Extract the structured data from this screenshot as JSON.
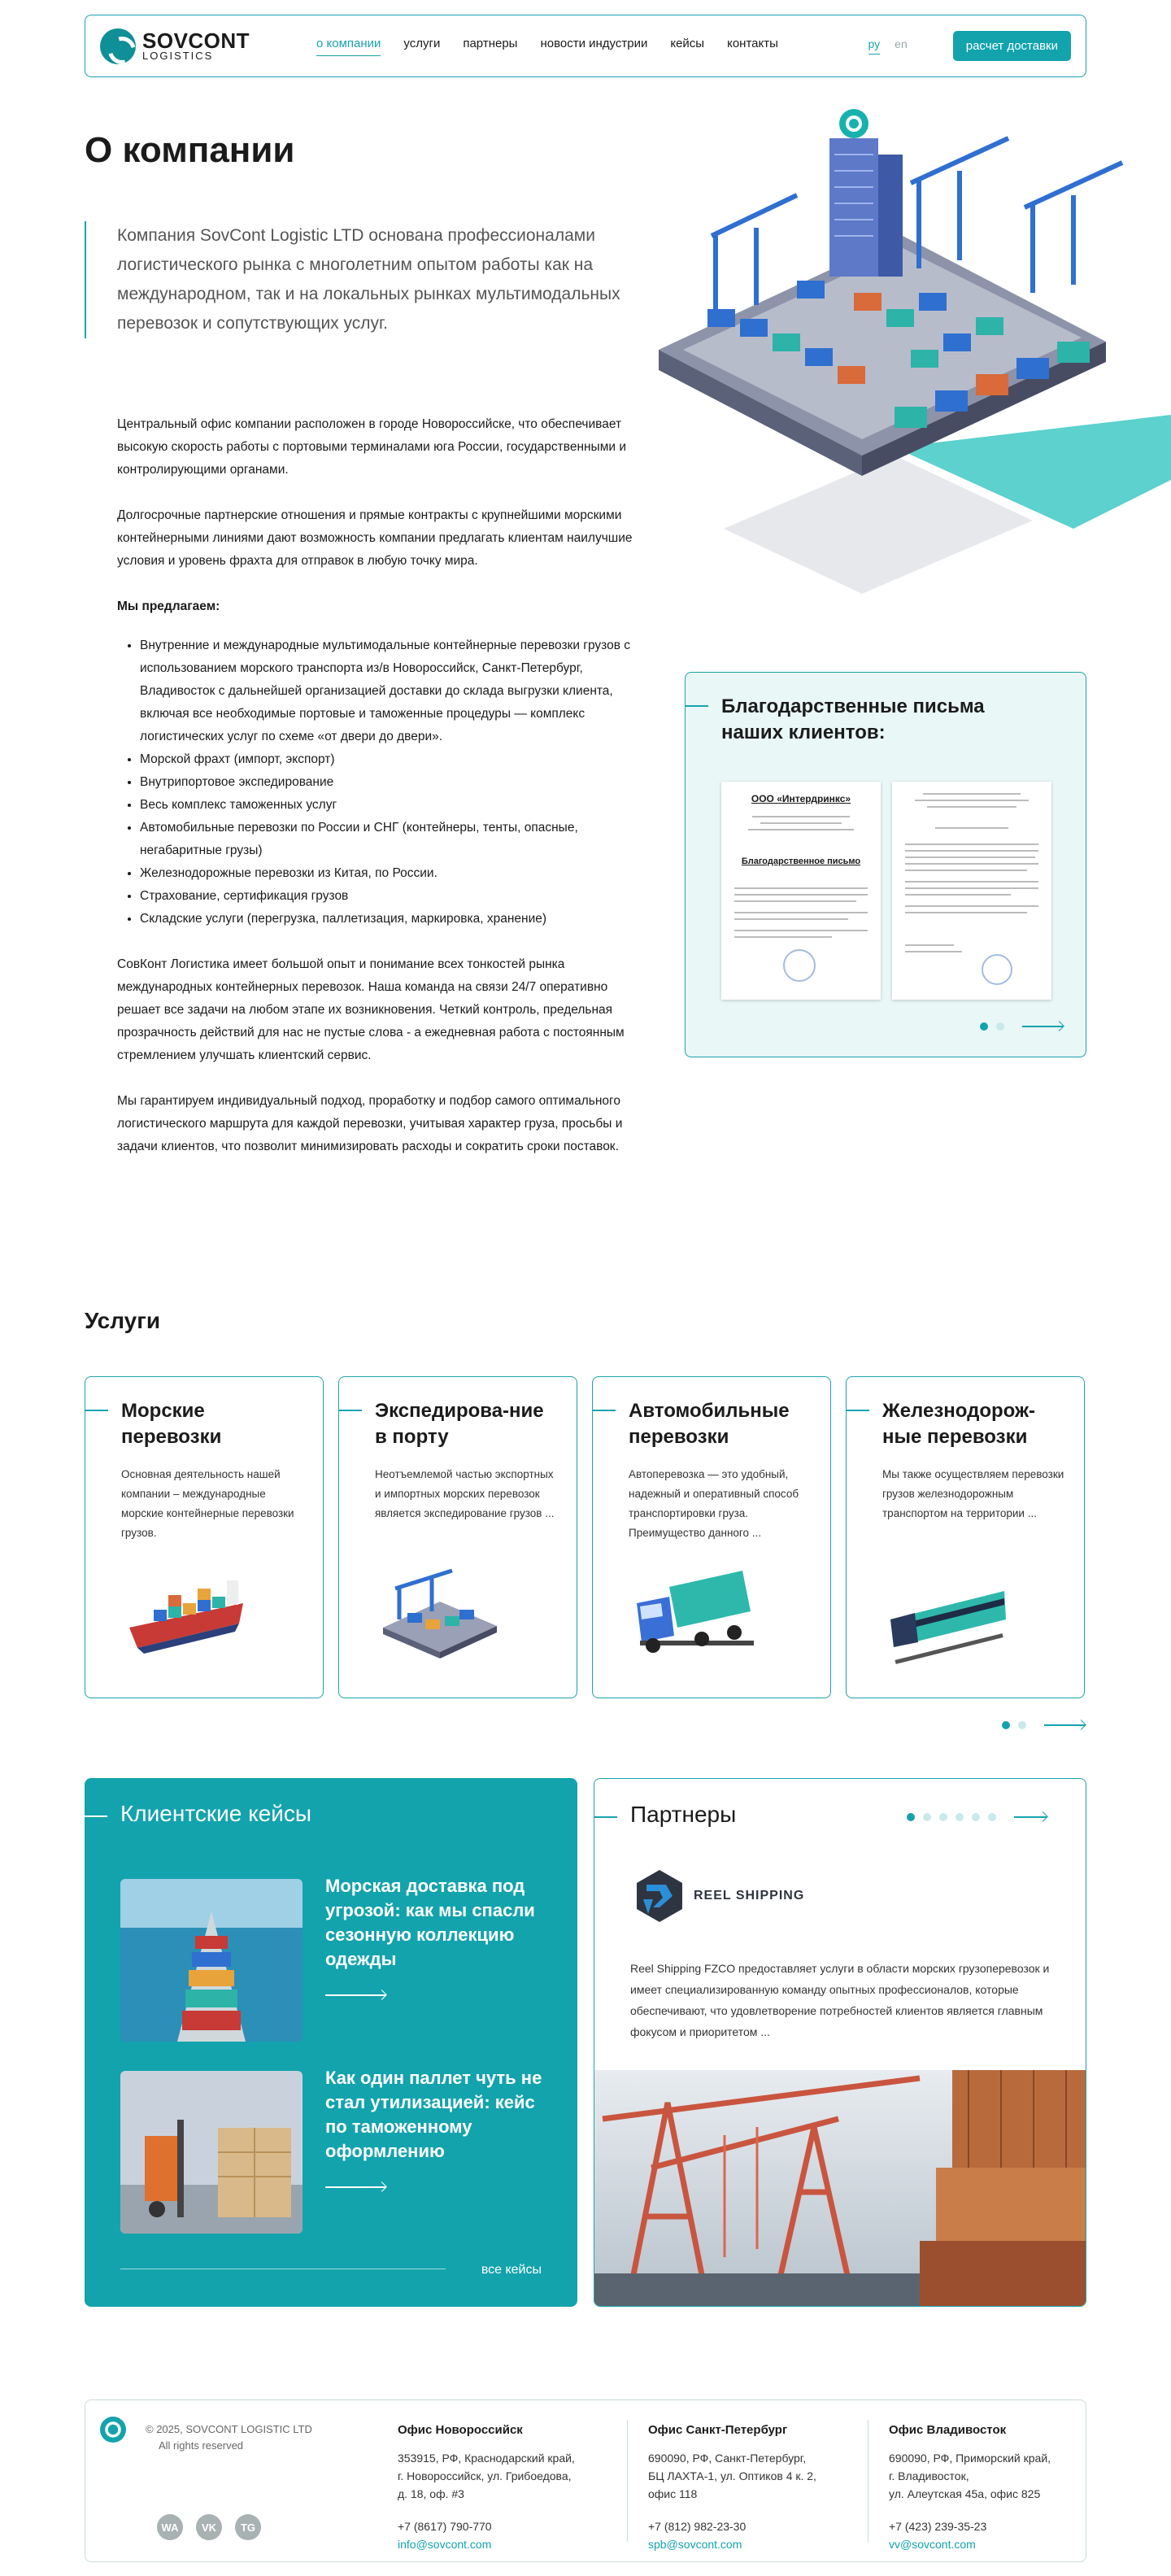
{
  "header": {
    "logo_title": "SOVCONT",
    "logo_subtitle": "LOGISTICS",
    "nav": [
      "о компании",
      "услуги",
      "партнеры",
      "новости индустрии",
      "кейсы",
      "контакты"
    ],
    "lang_active": "ру",
    "lang_other": "en",
    "cta": "расчет доставки"
  },
  "about": {
    "title": "О компании",
    "lead": "Компания SovCont Logistic LTD основана профессионалами логистического рынка с многолетним опытом работы как на международном, так и на локальных рынках мультимодальных перевозок и сопутствующих услуг.",
    "p1": "Центральный офис компании расположен в городе Новороссийске, что обеспечивает высокую скорость работы с портовыми терминалами юга России, государственными и контролирующими органами.",
    "p2": "Долгосрочные партнерские отношения и прямые контракты с крупнейшими морскими контейнерными линиями дают возможность компании предлагать клиентам наилучшие условия и уровень фрахта для отправок в любую точку мира.",
    "offer_heading": "Мы предлагаем:",
    "offers": [
      "Внутренние и международные мультимодальные контейнерные перевозки грузов с использованием морского транспорта из/в Новороссийск, Санкт-Петербург, Владивосток с дальнейшей организацией доставки до склада выгрузки клиента, включая все необходимые портовые и таможенные процедуры — комплекс логистических услуг по схеме «от двери до двери».",
      "Морской фрахт (импорт, экспорт)",
      "Внутрипортовое экспедирование",
      "Весь комплекс таможенных услуг",
      "Автомобильные перевозки по России и СНГ (контейнеры, тенты, опасные, негабаритные грузы)",
      "Железнодорожные перевозки из Китая, по России.",
      "Страхование, сертификация грузов",
      "Складские услуги (перегрузка, паллетизация, маркировка, хранение)"
    ],
    "p3": "СовКонт Логистика имеет большой опыт и понимание всех тонкостей рынка международных контейнерных перевозок. Наша команда на связи 24/7 оперативно решает все задачи на любом этапе их возникновения. Четкий контроль, предельная прозрачность действий для нас не пустые слова - а ежедневная работа с постоянным стремлением улучшать клиентский сервис.",
    "p4": "Мы гарантируем индивидуальный подход, проработку и подбор самого оптимального логистического маршрута для каждой перевозки, учитывая характер груза, просьбы и задачи клиентов, что позволит минимизировать расходы и сократить сроки поставок."
  },
  "letters": {
    "title": "Благодарственные письма наших клиентов:",
    "doc1_company": "ООО «Интердринкс»",
    "doc1_heading": "Благодарственное письмо",
    "slide_active": 1,
    "slide_count": 2
  },
  "services": {
    "title": "Услуги",
    "cards": [
      {
        "title": "Морские перевозки",
        "text": "Основная деятельность нашей компании – международные морские контейнерные перевозки грузов."
      },
      {
        "title": "Экспедирова-ние в порту",
        "text": "Неотъемлемой частью экспортных и импортных морских перевозок является экспедирование грузов ..."
      },
      {
        "title": "Автомобильные перевозки",
        "text": "Автоперевозка — это удобный, надежный и оперативный способ транспортировки груза. Преимущество данного ..."
      },
      {
        "title": "Железнодорож-ные перевозки",
        "text": "Мы также осуществляем перевозки грузов железнодорожным транспортом на территории ..."
      }
    ],
    "slide_active": 1,
    "slide_count": 2
  },
  "cases": {
    "title": "Клиентские кейсы",
    "items": [
      {
        "title": "Морская доставка под угрозой: как мы спасли сезонную коллекцию одежды"
      },
      {
        "title": "Как один паллет чуть не стал утилизацией: кейс по таможенному оформлению"
      }
    ],
    "all_link": "все кейсы"
  },
  "partners": {
    "title": "Партнеры",
    "logo_name": "REEL SHIPPING",
    "text": "Reel Shipping FZCO предоставляет услуги в области морских грузоперевозок и имеет специализированную команду опытных профессионалов, которые обеспечивают, что удовлетворение потребностей клиентов является главным фокусом и приоритетом ...",
    "slide_active": 1,
    "slide_count": 6
  },
  "footer": {
    "copyright": "© 2025, SOVCONT LOGISTIC LTD",
    "rights": "All rights reserved",
    "social": [
      "WA",
      "VK",
      "TG"
    ],
    "offices": [
      {
        "title": "Офис Новороссийск",
        "addr1": "353915, РФ, Краснодарский край,",
        "addr2": "г. Новороссийск, ул. Грибоедова,",
        "addr3": "д. 18, оф. #3",
        "phone": "+7 (8617) 790-770",
        "email": "info@sovcont.com"
      },
      {
        "title": "Офис Санкт-Петербург",
        "addr1": "690090, РФ, Санкт-Петербург,",
        "addr2": "БЦ ЛАХТА-1, ул. Оптиков 4 к. 2,",
        "addr3": "офис 118",
        "phone": "+7 (812) 982-23-30",
        "email": "spb@sovcont.com"
      },
      {
        "title": "Офис Владивосток",
        "addr1": "690090, РФ, Приморский край,",
        "addr2": "г. Владивосток,",
        "addr3": "ул. Алеутская 45а, офис 825",
        "phone": "+7 (423) 239-35-23",
        "email": "vv@sovcont.com"
      }
    ]
  },
  "colors": {
    "accent": "#13a3ad",
    "text": "#1b1b1b"
  }
}
